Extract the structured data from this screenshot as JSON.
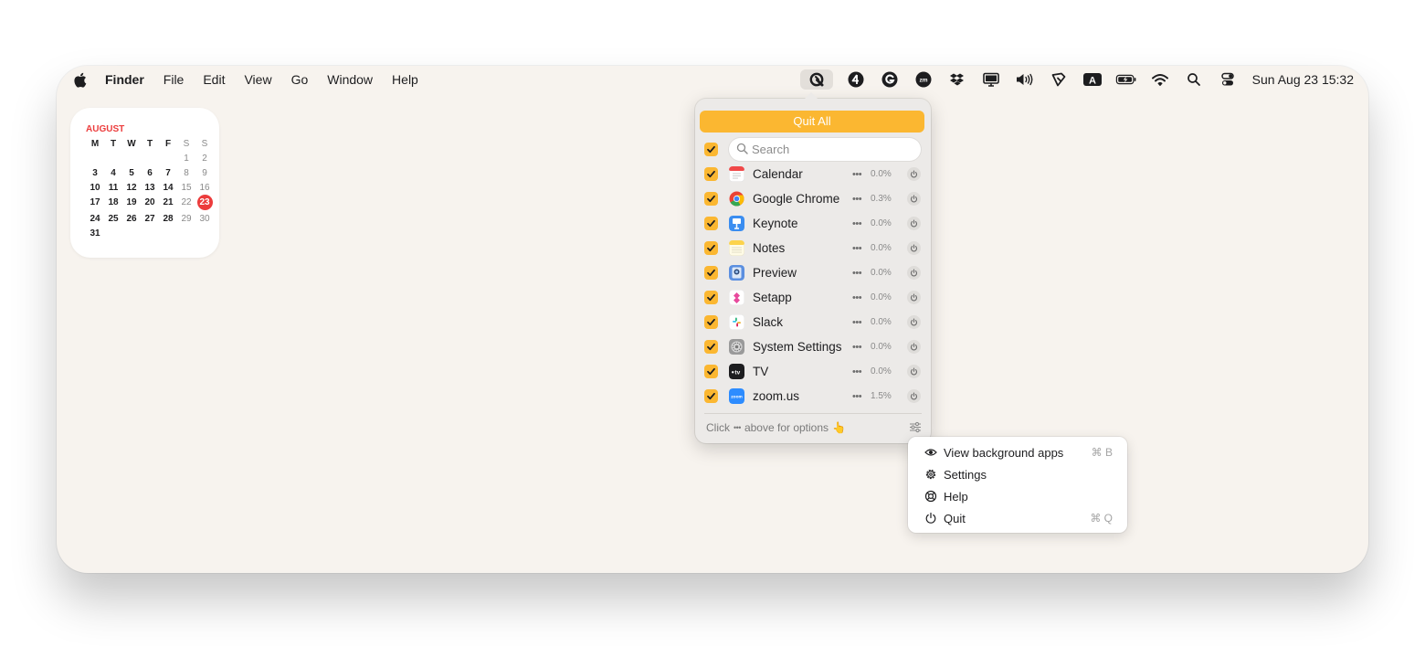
{
  "menubar": {
    "app_name": "Finder",
    "menus": [
      "File",
      "Edit",
      "View",
      "Go",
      "Window",
      "Help"
    ],
    "clock": "Sun Aug 23  15:32",
    "status_icons": [
      "quitter-icon",
      "number-4-icon",
      "grammarly-icon",
      "zoom-menu-icon",
      "dropbox-icon",
      "display-icon",
      "volume-icon",
      "shortcut-icon",
      "input-source-icon",
      "battery-icon",
      "wifi-icon",
      "spotlight-search-icon",
      "control-center-icon"
    ],
    "input_source_letter": "A",
    "zoom_icon_text": "zm"
  },
  "calendar": {
    "month": "AUGUST",
    "weekdays": [
      "M",
      "T",
      "W",
      "T",
      "F",
      "S",
      "S"
    ],
    "weeks": [
      [
        "",
        "",
        "",
        "",
        "",
        "1",
        "2"
      ],
      [
        "3",
        "4",
        "5",
        "6",
        "7",
        "8",
        "9"
      ],
      [
        "10",
        "11",
        "12",
        "13",
        "14",
        "15",
        "16"
      ],
      [
        "17",
        "18",
        "19",
        "20",
        "21",
        "22",
        "23"
      ],
      [
        "24",
        "25",
        "26",
        "27",
        "28",
        "29",
        "30"
      ],
      [
        "31",
        "",
        "",
        "",
        "",
        "",
        ""
      ]
    ],
    "today": "23"
  },
  "panel": {
    "quit_all_label": "Quit All",
    "search_placeholder": "Search",
    "apps": [
      {
        "name": "Calendar",
        "cpu": "0.0%",
        "icon": "calendar-app-icon"
      },
      {
        "name": "Google Chrome",
        "cpu": "0.3%",
        "icon": "chrome-app-icon"
      },
      {
        "name": "Keynote",
        "cpu": "0.0%",
        "icon": "keynote-app-icon"
      },
      {
        "name": "Notes",
        "cpu": "0.0%",
        "icon": "notes-app-icon"
      },
      {
        "name": "Preview",
        "cpu": "0.0%",
        "icon": "preview-app-icon"
      },
      {
        "name": "Setapp",
        "cpu": "0.0%",
        "icon": "setapp-app-icon"
      },
      {
        "name": "Slack",
        "cpu": "0.0%",
        "icon": "slack-app-icon"
      },
      {
        "name": "System Settings",
        "cpu": "0.0%",
        "icon": "system-settings-app-icon"
      },
      {
        "name": "TV",
        "cpu": "0.0%",
        "icon": "tv-app-icon"
      },
      {
        "name": "zoom.us",
        "cpu": "1.5%",
        "icon": "zoom-app-icon"
      }
    ],
    "dots_label": "•••",
    "tv_icon_text": "tv",
    "zoom_icon_text": "zoom",
    "footer_pre": "Click",
    "footer_dots": "•••",
    "footer_post": "above for options",
    "footer_hand": "👆"
  },
  "options_menu": {
    "items": [
      {
        "label": "View background apps",
        "shortcut": "⌘ B",
        "icon": "eye-icon"
      },
      {
        "label": "Settings",
        "shortcut": "",
        "icon": "gear-icon"
      },
      {
        "label": "Help",
        "shortcut": "",
        "icon": "lifebuoy-icon"
      },
      {
        "label": "Quit",
        "shortcut": "⌘ Q",
        "icon": "power-icon"
      }
    ]
  },
  "colors": {
    "accent": "#fbb731",
    "today": "#ec3c3c",
    "desktop": "#f7f3ee"
  }
}
